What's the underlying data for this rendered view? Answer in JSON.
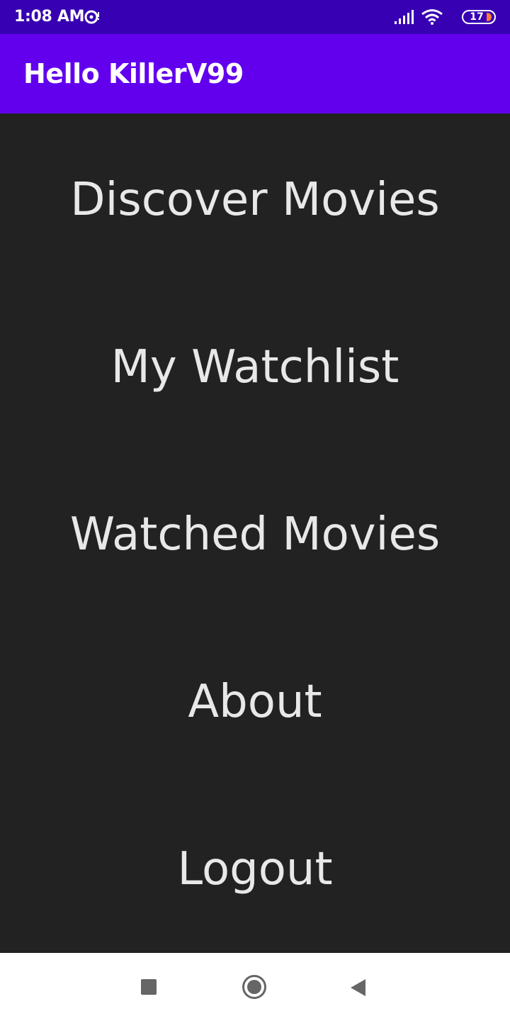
{
  "status_bar": {
    "time": "1:08 AM",
    "app_icon": "music-disc-icon",
    "signal_icon": "signal-icon",
    "wifi_icon": "wifi-icon",
    "battery_level": "17"
  },
  "app_bar": {
    "title": "Hello KillerV99"
  },
  "menu": {
    "items": [
      {
        "label": "Discover Movies"
      },
      {
        "label": "My Watchlist"
      },
      {
        "label": "Watched Movies"
      },
      {
        "label": "About"
      },
      {
        "label": "Logout"
      }
    ]
  },
  "nav_bar": {
    "recents_icon": "square-recents-icon",
    "home_icon": "circle-home-icon",
    "back_icon": "triangle-back-icon"
  },
  "colors": {
    "status_bar": "#3700b3",
    "app_bar": "#6200ee",
    "background": "#222222",
    "menu_text": "#e8e8e8",
    "battery_accent": "#ff7a3c"
  }
}
